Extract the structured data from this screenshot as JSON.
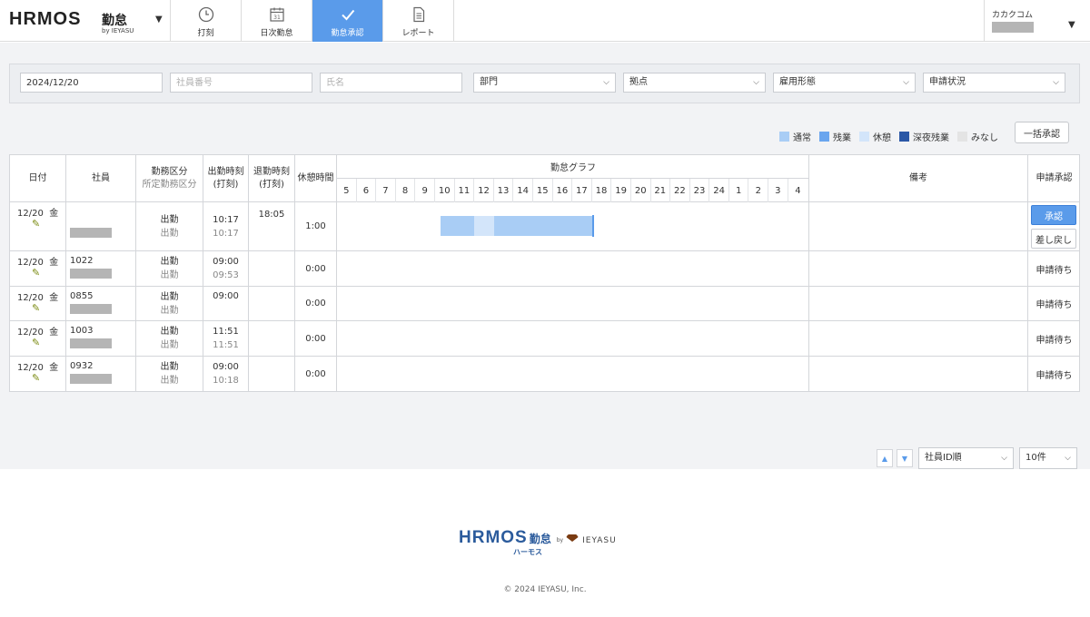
{
  "app": {
    "logo_word": "HRMOS",
    "logo_kintai": "勤怠",
    "logo_by": "by IEYASU"
  },
  "nav": [
    {
      "label": "打刻",
      "icon": "clock-icon",
      "active": false
    },
    {
      "label": "日次勤怠",
      "icon": "calendar-icon",
      "active": false
    },
    {
      "label": "勤怠承認",
      "icon": "check-icon",
      "active": true
    },
    {
      "label": "レポート",
      "icon": "document-icon",
      "active": false
    }
  ],
  "user": {
    "company": "カカクコム"
  },
  "filters": {
    "date_value": "2024/12/20",
    "employee_no_placeholder": "社員番号",
    "name_placeholder": "氏名",
    "department": "部門",
    "location": "拠点",
    "employment_type": "雇用形態",
    "application_status": "申請状況"
  },
  "legend": [
    {
      "label": "通常",
      "color": "#a9cdf5"
    },
    {
      "label": "残業",
      "color": "#6aa5ee"
    },
    {
      "label": "休憩",
      "color": "#d3e5fa"
    },
    {
      "label": "深夜残業",
      "color": "#2b57a6"
    },
    {
      "label": "みなし",
      "color": "#e4e4e4"
    }
  ],
  "bulk_approve_label": "一括承認",
  "table": {
    "headers": {
      "date": "日付",
      "employee": "社員",
      "work_type": "勤務区分",
      "scheduled_type": "所定勤務区分",
      "clock_in": "出勤時刻",
      "clock_in_sub": "(打刻)",
      "clock_out": "退勤時刻",
      "clock_out_sub": "(打刻)",
      "break_time": "休憩時間",
      "graph": "勤怠グラフ",
      "remarks": "備考",
      "approval": "申請承認"
    },
    "hours": [
      "5",
      "6",
      "7",
      "8",
      "9",
      "10",
      "11",
      "12",
      "13",
      "14",
      "15",
      "16",
      "17",
      "18",
      "19",
      "20",
      "21",
      "22",
      "23",
      "24",
      "1",
      "2",
      "3",
      "4"
    ],
    "rows": [
      {
        "date": "12/20",
        "weekday": "金",
        "employee_id": "",
        "work_type": "出勤",
        "scheduled_type": "出勤",
        "clock_in": "10:17",
        "clock_in_stamp": "10:17",
        "clock_out": "18:05",
        "break_time": "1:00",
        "status": "",
        "approve_label": "承認",
        "return_label": "差し戻し"
      },
      {
        "date": "12/20",
        "weekday": "金",
        "employee_id": "1022",
        "work_type": "出勤",
        "scheduled_type": "出勤",
        "clock_in": "09:00",
        "clock_in_stamp": "09:53",
        "clock_out": "",
        "break_time": "0:00",
        "status": "申請待ち"
      },
      {
        "date": "12/20",
        "weekday": "金",
        "employee_id": "0855",
        "work_type": "出勤",
        "scheduled_type": "出勤",
        "clock_in": "09:00",
        "clock_in_stamp": "",
        "clock_out": "",
        "break_time": "0:00",
        "status": "申請待ち"
      },
      {
        "date": "12/20",
        "weekday": "金",
        "employee_id": "1003",
        "work_type": "出勤",
        "scheduled_type": "出勤",
        "clock_in": "11:51",
        "clock_in_stamp": "11:51",
        "clock_out": "",
        "break_time": "0:00",
        "status": "申請待ち"
      },
      {
        "date": "12/20",
        "weekday": "金",
        "employee_id": "0932",
        "work_type": "出勤",
        "scheduled_type": "出勤",
        "clock_in": "09:00",
        "clock_in_stamp": "10:18",
        "clock_out": "",
        "break_time": "0:00",
        "status": "申請待ち"
      }
    ]
  },
  "pager": {
    "sort": "社員ID順",
    "per_page": "10件"
  },
  "footer": {
    "logo_word": "HRMOS",
    "logo_kintai": "勤怠",
    "logo_kana": "ハーモス",
    "by": "by",
    "ieyasu": "IEYASU",
    "copyright": "© 2024 IEYASU, Inc."
  }
}
